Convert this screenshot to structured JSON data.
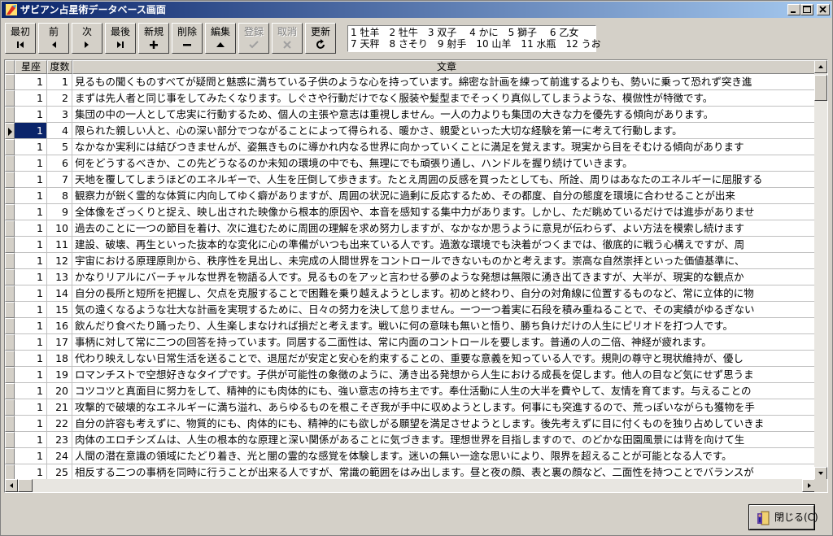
{
  "window": {
    "title": "ザビアン占星術データベース画面"
  },
  "toolbar": {
    "buttons": [
      {
        "label": "最初",
        "icon": "first-record-icon",
        "enabled": true
      },
      {
        "label": "前",
        "icon": "prior-record-icon",
        "enabled": true
      },
      {
        "label": "次",
        "icon": "next-record-icon",
        "enabled": true
      },
      {
        "label": "最後",
        "icon": "last-record-icon",
        "enabled": true
      },
      {
        "label": "新規",
        "icon": "plus-icon",
        "enabled": true
      },
      {
        "label": "削除",
        "icon": "minus-icon",
        "enabled": true
      },
      {
        "label": "編集",
        "icon": "edit-triangle-icon",
        "enabled": true
      },
      {
        "label": "登録",
        "icon": "check-icon",
        "enabled": false
      },
      {
        "label": "取消",
        "icon": "x-icon",
        "enabled": false
      },
      {
        "label": "更新",
        "icon": "refresh-icon",
        "enabled": true
      }
    ]
  },
  "sign_legend": {
    "line1": "1 牡羊　2 牡牛　3 双子　 4 かに　5 獅子　 6 乙女",
    "line2": "7 天秤　8 さそり　9 射手　10 山羊　11 水瓶　12 うお"
  },
  "grid": {
    "columns": [
      "星座",
      "度数",
      "文章"
    ],
    "selected_row": 3,
    "rows": [
      {
        "sign": "1",
        "degree": "1",
        "text": "見るもの聞くものすべてが疑問と魅惑に満ちている子供のような心を持っています。綿密な計画を練って前進するよりも、勢いに乗って恐れず突き進"
      },
      {
        "sign": "1",
        "degree": "2",
        "text": "まずは先人者と同じ事をしてみたくなります。しぐさや行動だけでなく服装や髪型までそっくり真似してしまうような、模倣性が特徴です。"
      },
      {
        "sign": "1",
        "degree": "3",
        "text": "集団の中の一人として忠実に行動するため、個人の主張や意志は重視しません。一人の力よりも集団の大きな力を優先する傾向があります。"
      },
      {
        "sign": "1",
        "degree": "4",
        "text": "限られた親しい人と、心の深い部分でつながることによって得られる、暖かさ、親愛といった大切な経験を第一に考えて行動します。"
      },
      {
        "sign": "1",
        "degree": "5",
        "text": "なかなか実利には結びつきませんが、姿無きものに導かれ内なる世界に向かっていくことに満足を覚えます。現実から目をそむける傾向があります"
      },
      {
        "sign": "1",
        "degree": "6",
        "text": "何をどうするべきか、この先どうなるのか未知の環境の中でも、無理にでも頑張り通し、ハンドルを握り続けていきます。"
      },
      {
        "sign": "1",
        "degree": "7",
        "text": "天地を覆してしまうほどのエネルギーで、人生を圧倒して歩きます。たとえ周囲の反感を買ったとしても、所詮、周りはあなたのエネルギーに屈服する"
      },
      {
        "sign": "1",
        "degree": "8",
        "text": "観察力が鋭く霊的な体質に内向してゆく癖がありますが、周囲の状況に過剰に反応するため、その都度、自分の態度を環境に合わせることが出来"
      },
      {
        "sign": "1",
        "degree": "9",
        "text": "全体像をざっくりと捉え、映し出された映像から根本的原因や、本音を感知する集中力があります。しかし、ただ眺めているだけでは進歩がありませ"
      },
      {
        "sign": "1",
        "degree": "10",
        "text": "過去のことに一つの節目を着け、次に進むために周囲の理解を求め努力しますが、なかなか思うように意見が伝わらず、よい方法を模索し続けます"
      },
      {
        "sign": "1",
        "degree": "11",
        "text": "建設、破壊、再生といった抜本的な変化に心の準備がいつも出来ている人です。過激な環境でも決着がつくまでは、徹底的に戦う心構えですが、周"
      },
      {
        "sign": "1",
        "degree": "12",
        "text": "宇宙における原理原則から、秩序性を見出し、未完成の人間世界をコントロールできないものかと考えます。崇高な自然崇拝といった価値基準に、"
      },
      {
        "sign": "1",
        "degree": "13",
        "text": "かなりリアルにバーチャルな世界を物語る人です。見るものをアッと言わせる夢のような発想は無限に湧き出てきますが、大半が、現実的な観点か"
      },
      {
        "sign": "1",
        "degree": "14",
        "text": "自分の長所と短所を把握し、欠点を克服することで困難を乗り越えようとします。初めと終わり、自分の対角線に位置するものなど、常に立体的に物"
      },
      {
        "sign": "1",
        "degree": "15",
        "text": "気の遠くなるような壮大な計画を実現するために、日々の努力を決して怠りません。一つ一つ着実に石段を積み重ねることで、その実績がゆるぎない"
      },
      {
        "sign": "1",
        "degree": "16",
        "text": "飲んだり食べたり踊ったり、人生楽しまなければ損だと考えます。戦いに何の意味も無いと悟り、勝ち負けだけの人生にピリオドを打つ人です。"
      },
      {
        "sign": "1",
        "degree": "17",
        "text": "事柄に対して常に二つの回答を持っています。同居する二面性は、常に内面のコントロールを要します。普通の人の二倍、神経が疲れます。"
      },
      {
        "sign": "1",
        "degree": "18",
        "text": "代わり映えしない日常生活を送ることで、退屈だが安定と安心を約束することの、重要な意義を知っている人です。規則の尊守と現状維持が、優し"
      },
      {
        "sign": "1",
        "degree": "19",
        "text": "ロマンチストで空想好きなタイプです。子供が可能性の象徴のように、湧き出る発想から人生における成長を促します。他人の目など気にせず思うま"
      },
      {
        "sign": "1",
        "degree": "20",
        "text": "コツコツと真面目に努力をして、精神的にも肉体的にも、強い意志の持ち主です。奉仕活動に人生の大半を費やして、友情を育てます。与えることの"
      },
      {
        "sign": "1",
        "degree": "21",
        "text": "攻撃的で破壊的なエネルギーに満ち溢れ、あらゆるものを根こそぎ我が手中に収めようとします。何事にも突進するので、荒っぽいながらも獲物を手"
      },
      {
        "sign": "1",
        "degree": "22",
        "text": "自分の許容も考えずに、物質的にも、肉体的にも、精神的にも欲しがる願望を満足させようとします。後先考えずに目に付くものを独り占めしていきま"
      },
      {
        "sign": "1",
        "degree": "23",
        "text": "肉体のエロチシズムは、人生の根本的な原理と深い関係があることに気づきます。理想世界を目指しますので、のどかな田園風景には背を向けて生"
      },
      {
        "sign": "1",
        "degree": "24",
        "text": "人間の潜在意識の領域にたどり着き、光と闇の霊的な感覚を体験します。迷いの無い一途な思いにより、限界を超えることが可能となる人です。"
      },
      {
        "sign": "1",
        "degree": "25",
        "text": "相反する二つの事柄を同時に行うことが出来る人ですが、常識の範囲をはみ出します。昼と夜の顔、表と裏の顔など、二面性を持つことでバランスが"
      }
    ]
  },
  "footer": {
    "close_label": "閉じる(C)"
  }
}
